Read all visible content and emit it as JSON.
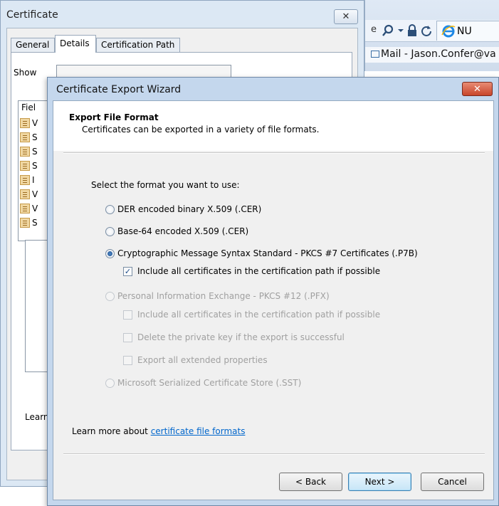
{
  "browser": {
    "address_tail": "e",
    "favorites_item": "Mail - Jason.Confer@va",
    "tab_label": "NU"
  },
  "cert_dialog": {
    "title": "Certificate",
    "close_label": "✕",
    "tabs": [
      {
        "label": "General"
      },
      {
        "label": "Details"
      },
      {
        "label": "Certification Path"
      }
    ],
    "show_label": "Show",
    "fields_header": "Fiel",
    "fields": [
      {
        "label": "V"
      },
      {
        "label": "S"
      },
      {
        "label": "S"
      },
      {
        "label": "S"
      },
      {
        "label": "I"
      },
      {
        "label": "V"
      },
      {
        "label": "V"
      },
      {
        "label": "S"
      }
    ],
    "learn_more": "Learn"
  },
  "wizard": {
    "title": "Certificate Export Wizard",
    "close_label": "✕",
    "header_title": "Export File Format",
    "header_subtitle": "Certificates can be exported in a variety of file formats.",
    "prompt": "Select the format you want to use:",
    "options": [
      {
        "label": "DER encoded binary X.509 (.CER)",
        "selected": false,
        "enabled": true
      },
      {
        "label": "Base-64 encoded X.509 (.CER)",
        "selected": false,
        "enabled": true
      },
      {
        "label": "Cryptographic Message Syntax Standard - PKCS #7 Certificates (.P7B)",
        "selected": true,
        "enabled": true
      },
      {
        "label": "Personal Information Exchange - PKCS #12 (.PFX)",
        "selected": false,
        "enabled": false
      },
      {
        "label": "Microsoft Serialized Certificate Store (.SST)",
        "selected": false,
        "enabled": false
      }
    ],
    "p7b_include_all": {
      "label": "Include all certificates in the certification path if possible",
      "checked": true
    },
    "pfx_options": [
      {
        "label": "Include all certificates in the certification path if possible",
        "checked": false
      },
      {
        "label": "Delete the private key if the export is successful",
        "checked": false
      },
      {
        "label": "Export all extended properties",
        "checked": false
      }
    ],
    "learn_prefix": "Learn more about ",
    "learn_link": "certificate file formats",
    "buttons": {
      "back": "< Back",
      "next": "Next >",
      "cancel": "Cancel"
    }
  },
  "colors": {
    "link": "#0066cc",
    "title_bar": "#c4d7ed",
    "close_red": "#c8452b",
    "disabled_text": "#a0a0a0"
  }
}
